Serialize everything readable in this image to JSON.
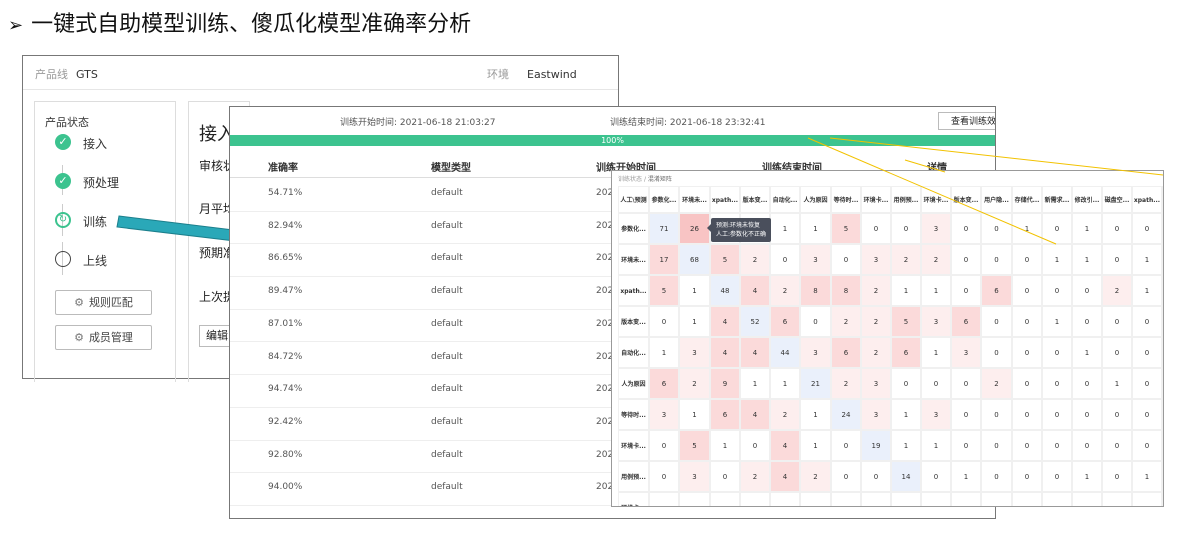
{
  "slide": {
    "bullet": "➢",
    "title": "一键式自助模型训练、傻瓜化模型准确率分析"
  },
  "product_window": {
    "product_line_label": "产品线",
    "product_line_value": "GTS",
    "env_label": "环境",
    "env_value": "Eastwind",
    "status_title": "产品状态",
    "steps": [
      {
        "label": "接入",
        "state": "done",
        "icon": "check-icon"
      },
      {
        "label": "预处理",
        "state": "done",
        "icon": "check-icon"
      },
      {
        "label": "训练",
        "state": "current",
        "icon": "refresh-icon"
      },
      {
        "label": "上线",
        "state": "todo",
        "icon": "empty-circle-icon"
      }
    ],
    "rule_match_button": "规则匹配",
    "member_mgmt_button": "成员管理",
    "detail_title": "接入",
    "detail_rows": [
      "审核状",
      "月平均",
      "预期准",
      "上次提"
    ],
    "edit_button": "编辑"
  },
  "training_window": {
    "start_time_text": "训练开始时间: 2021-06-18 21:03:27",
    "end_time_text": "训练结束时间: 2021-06-18 23:32:41",
    "view_button": "查看训练效",
    "progress": 1.0,
    "progress_text": "100%",
    "columns": [
      "准确率",
      "模型类型",
      "训练开始时间",
      "训练结束时间",
      "详情"
    ],
    "rows": [
      {
        "acc": "54.71%",
        "type": "default",
        "start": "202"
      },
      {
        "acc": "82.94%",
        "type": "default",
        "start": "202"
      },
      {
        "acc": "86.65%",
        "type": "default",
        "start": "202"
      },
      {
        "acc": "89.47%",
        "type": "default",
        "start": "202"
      },
      {
        "acc": "87.01%",
        "type": "default",
        "start": "202"
      },
      {
        "acc": "84.72%",
        "type": "default",
        "start": "202"
      },
      {
        "acc": "94.74%",
        "type": "default",
        "start": "202"
      },
      {
        "acc": "92.42%",
        "type": "default",
        "start": "202"
      },
      {
        "acc": "92.80%",
        "type": "default",
        "start": "202"
      },
      {
        "acc": "94.00%",
        "type": "default",
        "start": "202"
      }
    ]
  },
  "matrix_window": {
    "breadcrumb_parent": "训练状态",
    "breadcrumb_sep": "/",
    "breadcrumb_current": "混淆矩阵",
    "corner_label": "人工\\预测",
    "col_headers": [
      "参数化...",
      "环境未...",
      "xpath...",
      "版本变...",
      "自动化...",
      "人为原因",
      "等待时...",
      "环境卡...",
      "用例预...",
      "环境卡...",
      "版本变...",
      "用户隐...",
      "存储代...",
      "新需求...",
      "修改引...",
      "磁盘空...",
      "xpath...",
      "新需"
    ],
    "row_headers": [
      "参数化...",
      "环境未...",
      "xpath...",
      "版本变...",
      "自动化...",
      "人为原因",
      "等待时...",
      "环境卡...",
      "用例预...",
      "环境卡..."
    ],
    "values": [
      [
        "71",
        "26",
        "",
        "",
        "1",
        "1",
        "5",
        "0",
        "0",
        "3",
        "0",
        "0",
        "1",
        "0",
        "1",
        "0",
        "0",
        ""
      ],
      [
        "17",
        "68",
        "5",
        "2",
        "0",
        "3",
        "0",
        "3",
        "2",
        "2",
        "0",
        "0",
        "0",
        "1",
        "1",
        "0",
        "1",
        ""
      ],
      [
        "5",
        "1",
        "48",
        "4",
        "2",
        "8",
        "8",
        "2",
        "1",
        "1",
        "0",
        "6",
        "0",
        "0",
        "0",
        "2",
        "1",
        ""
      ],
      [
        "0",
        "1",
        "4",
        "52",
        "6",
        "0",
        "2",
        "2",
        "5",
        "3",
        "6",
        "0",
        "0",
        "1",
        "0",
        "0",
        "0",
        ""
      ],
      [
        "1",
        "3",
        "4",
        "4",
        "44",
        "3",
        "6",
        "2",
        "6",
        "1",
        "3",
        "0",
        "0",
        "0",
        "1",
        "0",
        "0",
        ""
      ],
      [
        "6",
        "2",
        "9",
        "1",
        "1",
        "21",
        "2",
        "3",
        "0",
        "0",
        "0",
        "2",
        "0",
        "0",
        "0",
        "1",
        "0",
        ""
      ],
      [
        "3",
        "1",
        "6",
        "4",
        "2",
        "1",
        "24",
        "3",
        "1",
        "3",
        "0",
        "0",
        "0",
        "0",
        "0",
        "0",
        "0",
        ""
      ],
      [
        "0",
        "5",
        "1",
        "0",
        "4",
        "1",
        "0",
        "19",
        "1",
        "1",
        "0",
        "0",
        "0",
        "0",
        "0",
        "0",
        "0",
        ""
      ],
      [
        "0",
        "3",
        "0",
        "2",
        "4",
        "2",
        "0",
        "0",
        "14",
        "0",
        "1",
        "0",
        "0",
        "0",
        "1",
        "0",
        "1",
        ""
      ],
      [
        "",
        "",
        "",
        "",
        "",
        "",
        "",
        "",
        "",
        "",
        "",
        "",
        "",
        "",
        "",
        "",
        "",
        ""
      ]
    ],
    "tooltip_line1": "预测:环境未恢复",
    "tooltip_line2": "人工:参数化不正确"
  },
  "colors": {
    "accent_green": "#3cc38f",
    "arrow_teal": "#2aa8b8",
    "callout_line": "#f2c200",
    "cell_pink": "#fbdada",
    "cell_blue": "#eaf0fb"
  }
}
